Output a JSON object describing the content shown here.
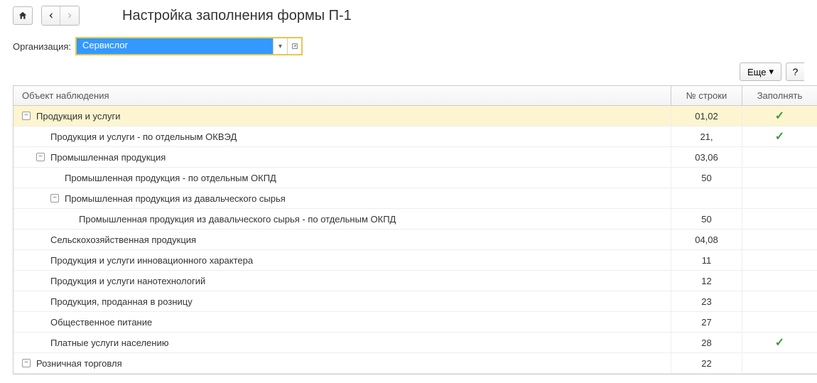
{
  "title": "Настройка заполнения формы П-1",
  "org_label": "Организация:",
  "org_value": "Сервислог",
  "more_btn": "Еще",
  "help_btn": "?",
  "headers": {
    "object": "Объект наблюдения",
    "row_no": "№ строки",
    "fill": "Заполнять"
  },
  "rows": [
    {
      "label": "Продукция и услуги",
      "indent": 0,
      "toggle": "−",
      "row_no": "01,02",
      "fill": true,
      "highlight": true
    },
    {
      "label": "Продукция и услуги - по отдельным ОКВЭД",
      "indent": 1,
      "toggle": "",
      "row_no": "21,",
      "fill": true
    },
    {
      "label": "Промышленная продукция",
      "indent": 1,
      "toggle": "−",
      "row_no": "03,06",
      "fill": false
    },
    {
      "label": "Промышленная продукция - по отдельным ОКПД",
      "indent": 2,
      "toggle": "",
      "row_no": "50",
      "fill": false
    },
    {
      "label": "Промышленная продукция из давальческого сырья",
      "indent": 2,
      "toggle": "−",
      "row_no": "",
      "fill": false
    },
    {
      "label": "Промышленная продукция из давальческого сырья - по отдельным ОКПД",
      "indent": 3,
      "toggle": "",
      "row_no": "50",
      "fill": false
    },
    {
      "label": "Сельскохозяйственная продукция",
      "indent": 1,
      "toggle": "",
      "row_no": "04,08",
      "fill": false
    },
    {
      "label": "Продукция и услуги инновационного характера",
      "indent": 1,
      "toggle": "",
      "row_no": "11",
      "fill": false
    },
    {
      "label": "Продукция и услуги нанотехнологий",
      "indent": 1,
      "toggle": "",
      "row_no": "12",
      "fill": false
    },
    {
      "label": "Продукция, проданная в розницу",
      "indent": 1,
      "toggle": "",
      "row_no": "23",
      "fill": false
    },
    {
      "label": "Общественное питание",
      "indent": 1,
      "toggle": "",
      "row_no": "27",
      "fill": false
    },
    {
      "label": "Платные услуги населению",
      "indent": 1,
      "toggle": "",
      "row_no": "28",
      "fill": true
    },
    {
      "label": "Розничная торговля",
      "indent": 0,
      "toggle": "−",
      "row_no": "22",
      "fill": false
    }
  ]
}
